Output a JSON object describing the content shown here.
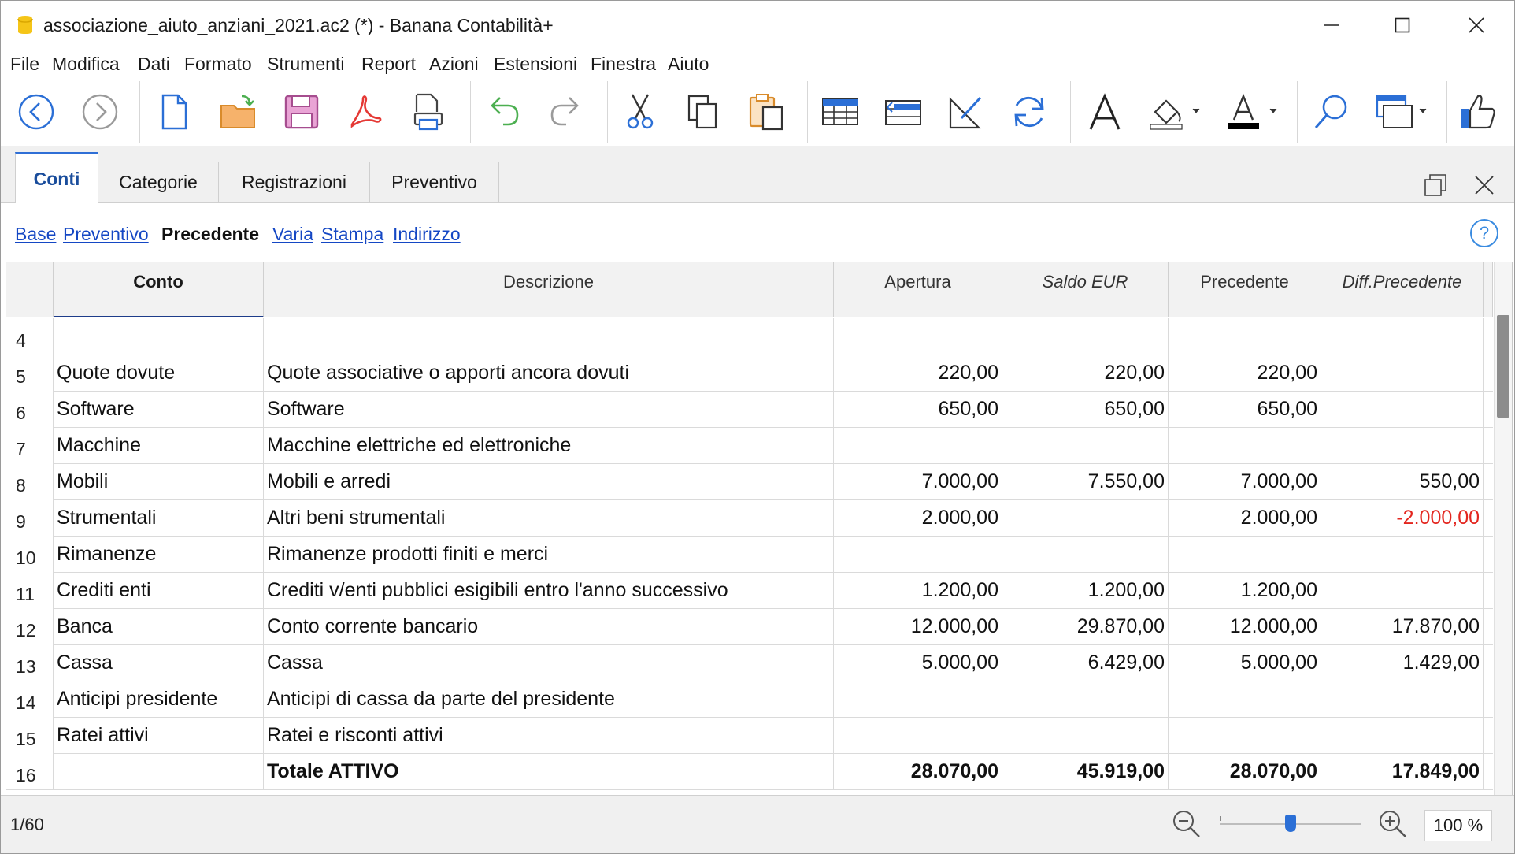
{
  "window": {
    "title": "associazione_aiuto_anziani_2021.ac2 (*) - Banana Contabilità+"
  },
  "menu": [
    "File",
    "Modifica",
    "Dati",
    "Formato",
    "Strumenti",
    "Report",
    "Azioni",
    "Estensioni",
    "Finestra",
    "Aiuto"
  ],
  "toolbar": {
    "icons": [
      "back-icon",
      "forward-icon",
      "new-file-icon",
      "open-folder-icon",
      "save-icon",
      "pdf-icon",
      "print-preview-icon",
      "undo-icon",
      "redo-icon",
      "cut-icon",
      "copy-icon",
      "paste-icon",
      "insert-row-icon",
      "add-row-icon",
      "edit-tools-icon",
      "recalculate-icon",
      "font-icon",
      "fill-color-icon",
      "text-color-icon",
      "search-icon",
      "window-copy-icon",
      "like-icon"
    ]
  },
  "tabs": [
    "Conti",
    "Categorie",
    "Registrazioni",
    "Preventivo"
  ],
  "views": [
    "Base",
    "Preventivo",
    "Precedente",
    "Varia",
    "Stampa",
    "Indirizzo"
  ],
  "table": {
    "columns": [
      "Conto",
      "Descrizione",
      "Apertura",
      "Saldo EUR",
      "Precedente",
      "Diff.Precedente"
    ],
    "rows": [
      {
        "n": "4",
        "conto": "",
        "descrizione": "",
        "apertura": "",
        "saldo": "",
        "precedente": "",
        "diff": ""
      },
      {
        "n": "5",
        "conto": "Quote dovute",
        "descrizione": "Quote associative o apporti ancora dovuti",
        "apertura": "220,00",
        "saldo": "220,00",
        "precedente": "220,00",
        "diff": ""
      },
      {
        "n": "6",
        "conto": "Software",
        "descrizione": "Software",
        "apertura": "650,00",
        "saldo": "650,00",
        "precedente": "650,00",
        "diff": ""
      },
      {
        "n": "7",
        "conto": "Macchine",
        "descrizione": "Macchine elettriche ed elettroniche",
        "apertura": "",
        "saldo": "",
        "precedente": "",
        "diff": ""
      },
      {
        "n": "8",
        "conto": "Mobili",
        "descrizione": "Mobili e arredi",
        "apertura": "7.000,00",
        "saldo": "7.550,00",
        "precedente": "7.000,00",
        "diff": "550,00"
      },
      {
        "n": "9",
        "conto": "Strumentali",
        "descrizione": "Altri beni strumentali",
        "apertura": "2.000,00",
        "saldo": "",
        "precedente": "2.000,00",
        "diff": "-2.000,00"
      },
      {
        "n": "10",
        "conto": "Rimanenze",
        "descrizione": "Rimanenze prodotti finiti e merci",
        "apertura": "",
        "saldo": "",
        "precedente": "",
        "diff": ""
      },
      {
        "n": "11",
        "conto": "Crediti enti",
        "descrizione": "Crediti v/enti pubblici esigibili entro l'anno successivo",
        "apertura": "1.200,00",
        "saldo": "1.200,00",
        "precedente": "1.200,00",
        "diff": ""
      },
      {
        "n": "12",
        "conto": "Banca",
        "descrizione": "Conto corrente bancario",
        "apertura": "12.000,00",
        "saldo": "29.870,00",
        "precedente": "12.000,00",
        "diff": "17.870,00"
      },
      {
        "n": "13",
        "conto": "Cassa",
        "descrizione": "Cassa",
        "apertura": "5.000,00",
        "saldo": "6.429,00",
        "precedente": "5.000,00",
        "diff": "1.429,00"
      },
      {
        "n": "14",
        "conto": "Anticipi presidente",
        "descrizione": "Anticipi di cassa da parte del presidente",
        "apertura": "",
        "saldo": "",
        "precedente": "",
        "diff": ""
      },
      {
        "n": "15",
        "conto": "Ratei attivi",
        "descrizione": "Ratei e risconti attivi",
        "apertura": "",
        "saldo": "",
        "precedente": "",
        "diff": ""
      },
      {
        "n": "16",
        "conto": "",
        "descrizione": "Totale ATTIVO",
        "apertura": "28.070,00",
        "saldo": "45.919,00",
        "precedente": "28.070,00",
        "diff": "17.849,00"
      }
    ]
  },
  "status": {
    "position": "1/60",
    "zoom": "100 %"
  },
  "colors": {
    "accent": "#2f6fd6",
    "link": "#1447c4",
    "negative": "#e3261f"
  }
}
